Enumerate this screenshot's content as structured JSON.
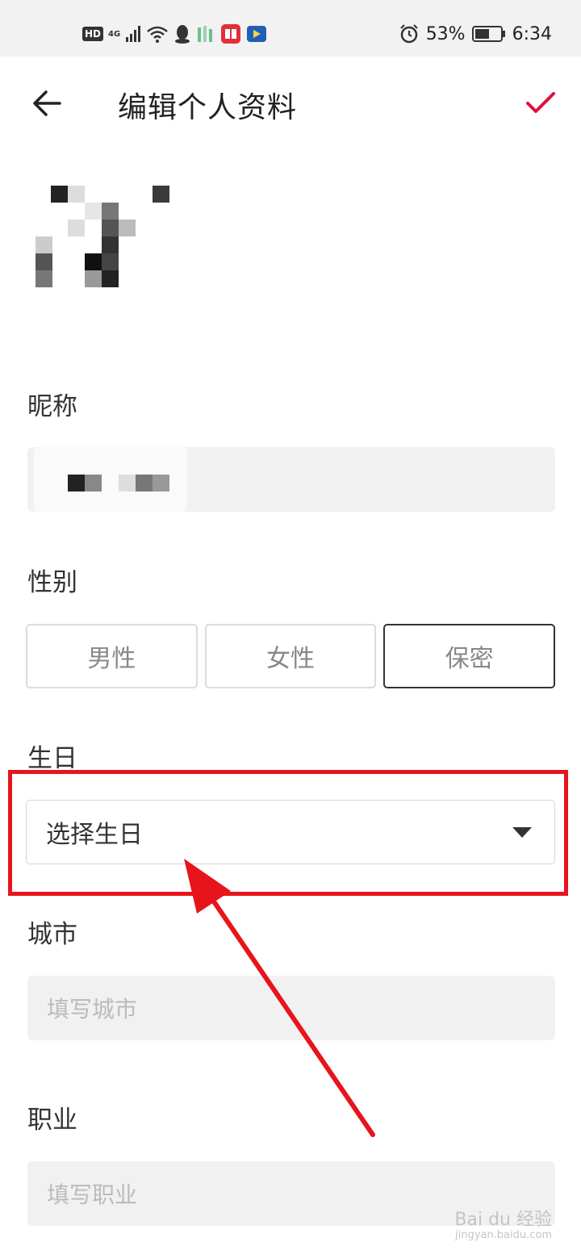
{
  "status_bar": {
    "left_badges": [
      "HD",
      "4G"
    ],
    "battery_percent": "53%",
    "time": "6:34",
    "icons": [
      "hd-icon",
      "signal-icon",
      "wifi-icon",
      "qq-icon",
      "app-icon",
      "reader-icon",
      "video-icon",
      "alarm-icon",
      "battery-icon"
    ]
  },
  "header": {
    "title": "编辑个人资料",
    "back_icon": "arrow-left-icon",
    "confirm_icon": "checkmark-icon"
  },
  "colors": {
    "accent": "#e0103c",
    "highlight": "#e8141c",
    "input_bg": "#f1f1f1"
  },
  "form": {
    "nickname_label": "昵称",
    "gender_label": "性别",
    "gender_options": [
      "男性",
      "女性",
      "保密"
    ],
    "gender_selected": "保密",
    "birthday_label": "生日",
    "birthday_value": "选择生日",
    "city_label": "城市",
    "city_placeholder": "填写城市",
    "job_label": "职业",
    "job_placeholder": "填写职业"
  },
  "watermark": {
    "brand": "Bai du 经验",
    "url": "jingyan.baidu.com"
  }
}
